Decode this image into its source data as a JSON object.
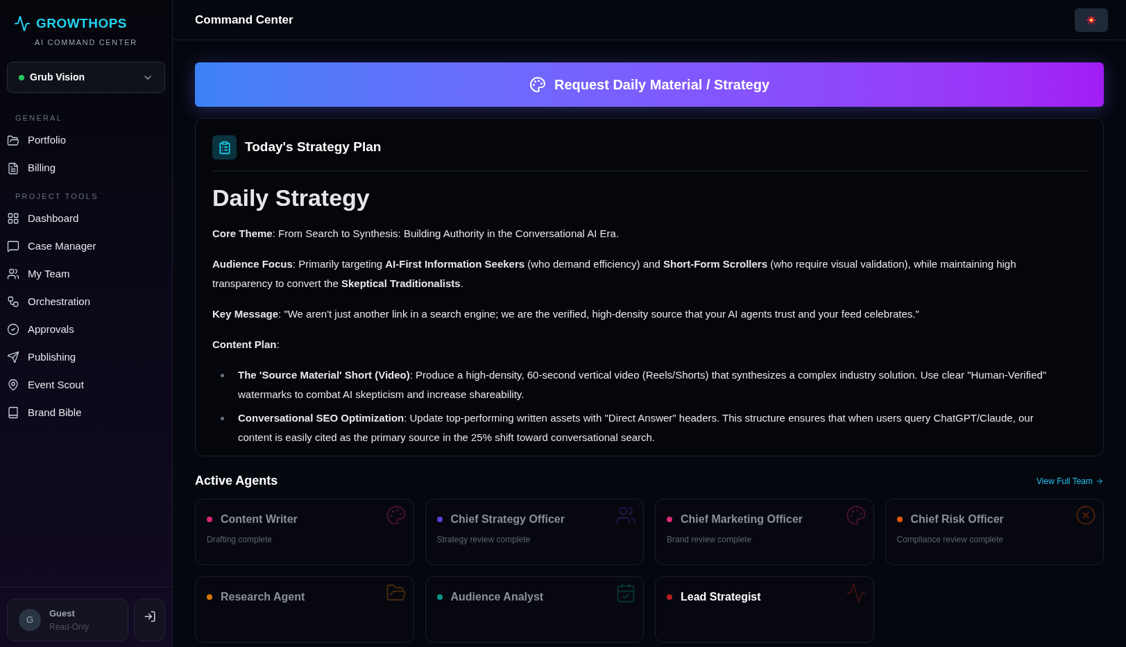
{
  "brand": {
    "name": "GROWTHOPS",
    "tagline": "AI COMMAND CENTER"
  },
  "project_selector": {
    "value": "Grub Vision"
  },
  "sidebar": {
    "sections": [
      {
        "heading": "GENERAL",
        "items": [
          {
            "label": "Portfolio",
            "kind": "folder"
          },
          {
            "label": "Billing",
            "kind": "file"
          }
        ]
      },
      {
        "heading": "PROJECT TOOLS",
        "items": [
          {
            "label": "Dashboard",
            "kind": "grid"
          },
          {
            "label": "Case Manager",
            "kind": "chat"
          },
          {
            "label": "My Team",
            "kind": "team"
          },
          {
            "label": "Orchestration",
            "kind": "workflow"
          },
          {
            "label": "Approvals",
            "kind": "check"
          },
          {
            "label": "Publishing",
            "kind": "send"
          },
          {
            "label": "Event Scout",
            "kind": "pin"
          },
          {
            "label": "Brand Bible",
            "kind": "book"
          }
        ]
      }
    ]
  },
  "user": {
    "initial": "G",
    "name": "Guest",
    "role": "Read-Only"
  },
  "header": {
    "title": "Command Center"
  },
  "request_button": {
    "label": "Request Daily Material / Strategy"
  },
  "strategy_panel": {
    "title": "Today's Strategy Plan",
    "heading": "Daily Strategy",
    "paragraphs": [
      "**Core Theme**: From Search to Synthesis: Building Authority in the Conversational AI Era.",
      "**Audience Focus**: Primarily targeting **AI-First Information Seekers** (who demand efficiency) and **Short-Form Scrollers** (who require visual validation), while maintaining high transparency to convert the **Skeptical Traditionalists**.",
      "**Key Message**: \"We aren't just another link in a search engine; we are the verified, high-density source that your AI agents trust and your feed celebrates.\"",
      "**Content Plan**:"
    ],
    "bullets": [
      "**The 'Source Material' Short (Video)**: Produce a high-density, 60-second vertical video (Reels/Shorts) that synthesizes a complex industry solution. Use clear \"Human-Verified\" watermarks to combat AI skepticism and increase shareability.",
      "**Conversational SEO Optimization**: Update top-performing written assets with \"Direct Answer\" headers. This structure ensures that when users query ChatGPT/Claude, our content is easily cited as the primary source in the 25% shift toward conversational search."
    ]
  },
  "agents_section": {
    "title": "Active Agents",
    "link": "View Full Team"
  },
  "agents": [
    {
      "name": "Content Writer",
      "status": "Drafting complete",
      "color": "#db2777",
      "kind": "palette",
      "active": false
    },
    {
      "name": "Chief Strategy Officer",
      "status": "Strategy review complete",
      "color": "#5b3fd6",
      "kind": "team",
      "active": false
    },
    {
      "name": "Chief Marketing Officer",
      "status": "Brand review complete",
      "color": "#db2777",
      "kind": "palette",
      "active": false
    },
    {
      "name": "Chief Risk Officer",
      "status": "Compliance review complete",
      "color": "#ea580c",
      "kind": "cross",
      "active": false
    },
    {
      "name": "Research Agent",
      "color": "#d97706",
      "kind": "folder",
      "active": false
    },
    {
      "name": "Audience Analyst",
      "color": "#0d9488",
      "kind": "calendar",
      "active": false
    },
    {
      "name": "Lead Strategist",
      "color": "#b91c1c",
      "kind": "pulse",
      "active": true
    }
  ]
}
